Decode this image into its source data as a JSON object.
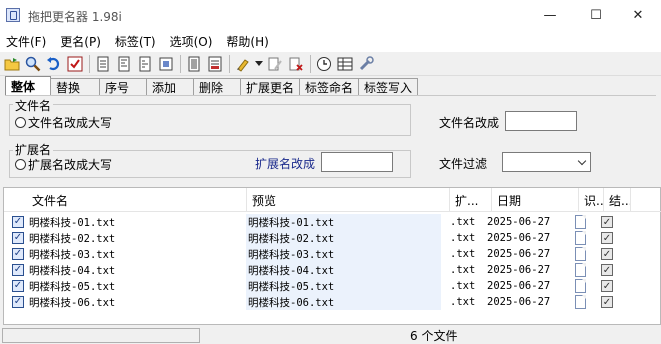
{
  "window": {
    "title": "拖把更名器 1.98i",
    "minimize": "—",
    "maximize": "☐",
    "close": "✕"
  },
  "menu": [
    "文件(F)",
    "更名(P)",
    "标签(T)",
    "选项(O)",
    "帮助(H)"
  ],
  "toolbar": [
    "open-folder-icon",
    "search-icon",
    "undo-icon",
    "check-icon",
    "rename-icon-1",
    "rename-icon-2",
    "rename-icon-3",
    "rename-icon-4",
    "list-icon",
    "report-icon",
    "brush-icon",
    "dropdown-icon",
    "tag-edit-icon",
    "tag-delete-icon",
    "clock-icon",
    "grid-icon",
    "tools-icon"
  ],
  "tabs": [
    "整体",
    "替换",
    "序号",
    "添加",
    "删除",
    "扩展更名",
    "标签命名",
    "标签写入"
  ],
  "panel": {
    "filename_group": "文件名",
    "filename_upper": "文件名改成大写",
    "filename_change": "文件名改成",
    "filename_value": "",
    "ext_group": "扩展名",
    "ext_upper": "扩展名改成大写",
    "ext_change": "扩展名改成",
    "ext_value": "",
    "filter_label": "文件过滤",
    "filter_value": ""
  },
  "columns": [
    "文件名",
    "预览",
    "扩...",
    "日期",
    "识...",
    "结..."
  ],
  "rows": [
    {
      "name": "明楼科技-01.txt",
      "preview": "明楼科技-01.txt",
      "ext": ".txt",
      "date": "2025-06-27"
    },
    {
      "name": "明楼科技-02.txt",
      "preview": "明楼科技-02.txt",
      "ext": ".txt",
      "date": "2025-06-27"
    },
    {
      "name": "明楼科技-03.txt",
      "preview": "明楼科技-03.txt",
      "ext": ".txt",
      "date": "2025-06-27"
    },
    {
      "name": "明楼科技-04.txt",
      "preview": "明楼科技-04.txt",
      "ext": ".txt",
      "date": "2025-06-27"
    },
    {
      "name": "明楼科技-05.txt",
      "preview": "明楼科技-05.txt",
      "ext": ".txt",
      "date": "2025-06-27"
    },
    {
      "name": "明楼科技-06.txt",
      "preview": "明楼科技-06.txt",
      "ext": ".txt",
      "date": "2025-06-27"
    }
  ],
  "status": {
    "count": "6 个文件"
  }
}
